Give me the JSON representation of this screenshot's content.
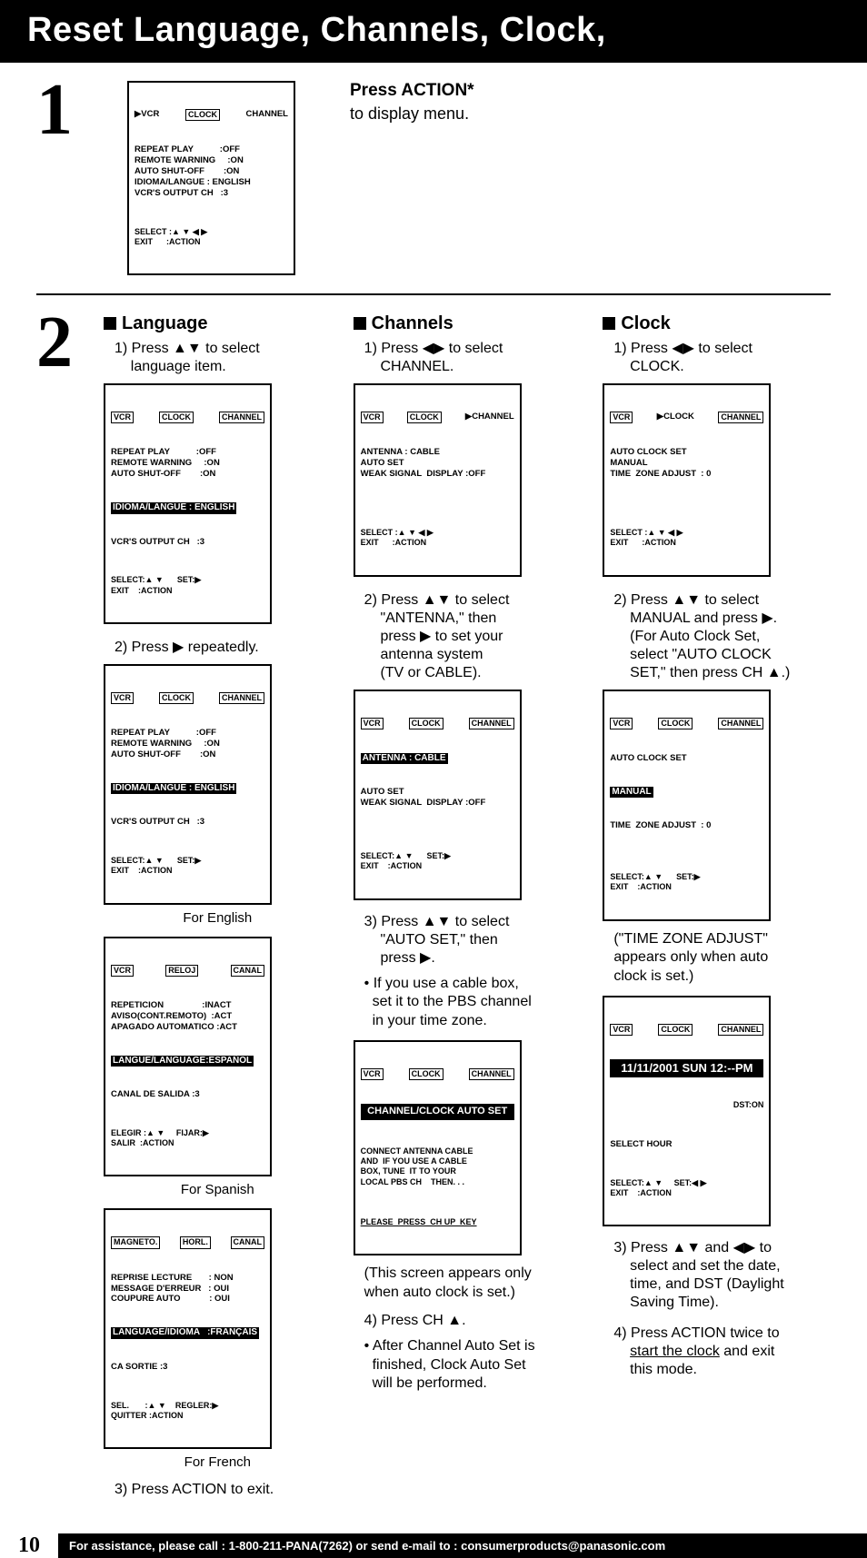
{
  "title": "Reset Language, Channels, Clock,",
  "step1": {
    "num": "1",
    "osd": {
      "tabs": {
        "vcr": "▶VCR",
        "clock": "CLOCK",
        "channel": "CHANNEL"
      },
      "lines": "REPEAT PLAY           :OFF\nREMOTE WARNING     :ON\nAUTO SHUT-OFF        :ON\nIDIOMA/LANGUE : ENGLISH\nVCR'S OUTPUT CH   :3",
      "footer": "SELECT :▲ ▼ ◀ ▶\nEXIT      :ACTION"
    },
    "hdr": "Press ACTION*",
    "sub": "to display menu."
  },
  "step2num": "2",
  "language": {
    "title": "Language",
    "s1": "1) Press ▲▼ to select\n    language item.",
    "osdA": {
      "tabs": {
        "vcr": "VCR",
        "clock": "CLOCK",
        "channel": "CHANNEL"
      },
      "lines": "REPEAT PLAY           :OFF\nREMOTE WARNING     :ON\nAUTO SHUT-OFF        :ON",
      "hl": "IDIOMA/LANGUE : ENGLISH",
      "after": "VCR'S OUTPUT CH   :3",
      "footer": "SELECT:▲ ▼      SET:▶\nEXIT    :ACTION"
    },
    "s2": "2) Press ▶ repeatedly.",
    "osdB": {
      "tabs": {
        "vcr": "VCR",
        "clock": "CLOCK",
        "channel": "CHANNEL"
      },
      "lines": "REPEAT PLAY           :OFF\nREMOTE WARNING     :ON\nAUTO SHUT-OFF        :ON",
      "hl": "IDIOMA/LANGUE : ENGLISH",
      "after": "VCR'S OUTPUT CH   :3",
      "footer": "SELECT:▲ ▼      SET:▶\nEXIT    :ACTION"
    },
    "capEN": "For English",
    "osdES": {
      "tabs": {
        "vcr": "VCR",
        "clock": "RELOJ",
        "channel": "CANAL"
      },
      "lines": "REPETICION                :INACT\nAVISO(CONT.REMOTO)  :ACT\nAPAGADO AUTOMATICO :ACT",
      "hl": "LANGUE/LANGUAGE:ESPAÑOL",
      "after": "CANAL DE SALIDA :3",
      "footer": "ELEGIR :▲ ▼     FIJAR:▶\nSALIR  :ACTION"
    },
    "capES": "For Spanish",
    "osdFR": {
      "tabs": {
        "vcr": "MAGNETO.",
        "clock": "HORL.",
        "channel": "CANAL"
      },
      "lines": "REPRISE LECTURE       : NON\nMESSAGE D'ERREUR   : OUI\nCOUPURE AUTO            : OUI",
      "hl": "LANGUAGE/IDIOMA   :FRANÇAIS",
      "after": "CA SORTIE :3",
      "footer": "SEL.       :▲ ▼    REGLER:▶\nQUITTER :ACTION"
    },
    "capFR": "For French",
    "s3": "3) Press ACTION to exit."
  },
  "channels": {
    "title": "Channels",
    "s1": "1) Press ◀▶ to select\n    CHANNEL.",
    "osdA": {
      "tabs": {
        "vcr": "VCR",
        "clock": "CLOCK",
        "channel": "▶CHANNEL"
      },
      "lines": "ANTENNA : CABLE\nAUTO SET\nWEAK SIGNAL  DISPLAY :OFF",
      "footer": "SELECT :▲ ▼ ◀ ▶\nEXIT      :ACTION"
    },
    "s2": "2) Press ▲▼ to select\n    \"ANTENNA,\" then\n    press ▶ to set your\n    antenna system\n    (TV or CABLE).",
    "osdB": {
      "tabs": {
        "vcr": "VCR",
        "clock": "CLOCK",
        "channel": "CHANNEL"
      },
      "hl": "ANTENNA : CABLE",
      "lines": "AUTO SET\nWEAK SIGNAL  DISPLAY :OFF",
      "footer": "SELECT:▲ ▼      SET:▶\nEXIT    :ACTION"
    },
    "s3": "3) Press ▲▼ to select\n    \"AUTO SET,\" then\n    press ▶.",
    "bullet1": "• If you use a cable box,\n  set it to the PBS channel\n  in your time zone.",
    "osdC": {
      "tabs": {
        "vcr": "VCR",
        "clock": "CLOCK",
        "channel": "CHANNEL"
      },
      "banner": "CHANNEL/CLOCK AUTO SET",
      "lines": "CONNECT ANTENNA CABLE\nAND  IF YOU USE A CABLE\nBOX, TUNE  IT TO YOUR\nLOCAL PBS CH    THEN. . .",
      "footer": "PLEASE  PRESS  CH UP  KEY"
    },
    "note1": "(This screen appears only\nwhen auto clock is set.)",
    "s4": "4) Press CH ▲.",
    "bullet2": "• After Channel Auto Set is\n  finished, Clock Auto Set\n  will be performed."
  },
  "clock": {
    "title": "Clock",
    "s1": "1) Press ◀▶ to select\n    CLOCK.",
    "osdA": {
      "tabs": {
        "vcr": "VCR",
        "clock": "▶CLOCK",
        "channel": "CHANNEL"
      },
      "lines": "AUTO CLOCK SET\nMANUAL\nTIME  ZONE ADJUST  : 0",
      "footer": "SELECT :▲ ▼ ◀ ▶\nEXIT      :ACTION"
    },
    "s2": "2) Press ▲▼ to select\n    MANUAL and press ▶.\n    (For Auto Clock Set,\n    select \"AUTO CLOCK\n    SET,\" then press CH ▲.)",
    "osdB": {
      "tabs": {
        "vcr": "VCR",
        "clock": "CLOCK",
        "channel": "CHANNEL"
      },
      "pre": "AUTO CLOCK SET",
      "hl": "MANUAL",
      "lines": "TIME  ZONE ADJUST  : 0",
      "footer": "SELECT:▲ ▼      SET:▶\nEXIT    :ACTION"
    },
    "note1": "(\"TIME ZONE ADJUST\"\nappears only when auto\nclock is set.)",
    "osdC": {
      "tabs": {
        "vcr": "VCR",
        "clock": "CLOCK",
        "channel": "CHANNEL"
      },
      "banner": "11/11/2001 SUN 12:--PM",
      "dst": "DST:ON",
      "lines": "SELECT HOUR",
      "footer": "SELECT:▲ ▼     SET:◀ ▶\nEXIT    :ACTION"
    },
    "s3": "3) Press ▲▼ and ◀▶ to\n    select and set the date,\n    time, and DST (Daylight\n    Saving Time).",
    "s4a": "4) Press ACTION twice to\n    ",
    "s4u": "start the clock",
    "s4b": " and exit\n    this mode."
  },
  "footer": {
    "pagenum": "10",
    "assist": "For assistance, please call : 1-800-211-PANA(7262) or send e-mail to : consumerproducts@panasonic.com"
  }
}
